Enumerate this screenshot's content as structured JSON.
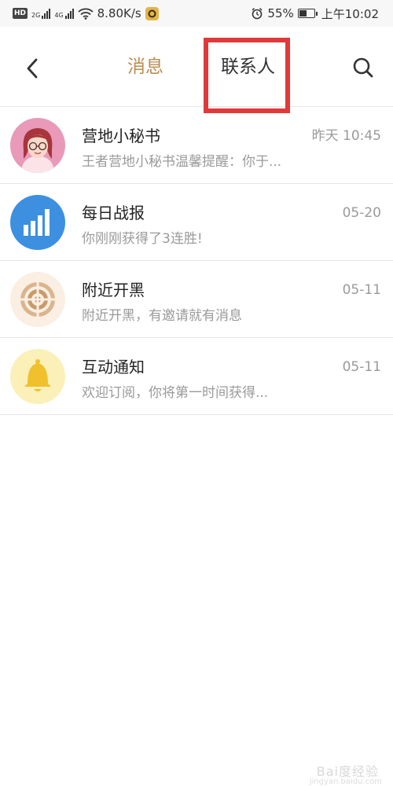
{
  "status_bar": {
    "hd_badge": "HD",
    "net_1": "2G",
    "net_2": "4G",
    "speed": "8.80K/s",
    "battery": "55%",
    "battery_level": 0.55,
    "time": "上午10:02"
  },
  "header": {
    "back_icon": "chevron-left-icon",
    "tabs": [
      {
        "label": "消息",
        "active": true
      },
      {
        "label": "联系人",
        "active": false
      }
    ],
    "search_icon": "search-icon",
    "active_color": "#b98d52",
    "highlight_color": "#e0393a"
  },
  "messages": [
    {
      "title": "营地小秘书",
      "time": "昨天  10:45",
      "preview": "王者营地小秘书温馨提醒：你于...",
      "icon": "girl-avatar-icon"
    },
    {
      "title": "每日战报",
      "time": "05-20",
      "preview": "你刚刚获得了3连胜!",
      "icon": "bar-chart-icon",
      "color": "#3d8fe0"
    },
    {
      "title": "附近开黑",
      "time": "05-11",
      "preview": "附近开黑，有邀请就有消息",
      "icon": "radar-icon",
      "color": "#c89b6a"
    },
    {
      "title": "互动通知",
      "time": "05-11",
      "preview": "欢迎订阅，你将第一时间获得...",
      "icon": "bell-icon",
      "color": "#f0c12c"
    }
  ],
  "watermark": {
    "text": "Bai度经验",
    "url": "jingyan.baidu.com"
  }
}
